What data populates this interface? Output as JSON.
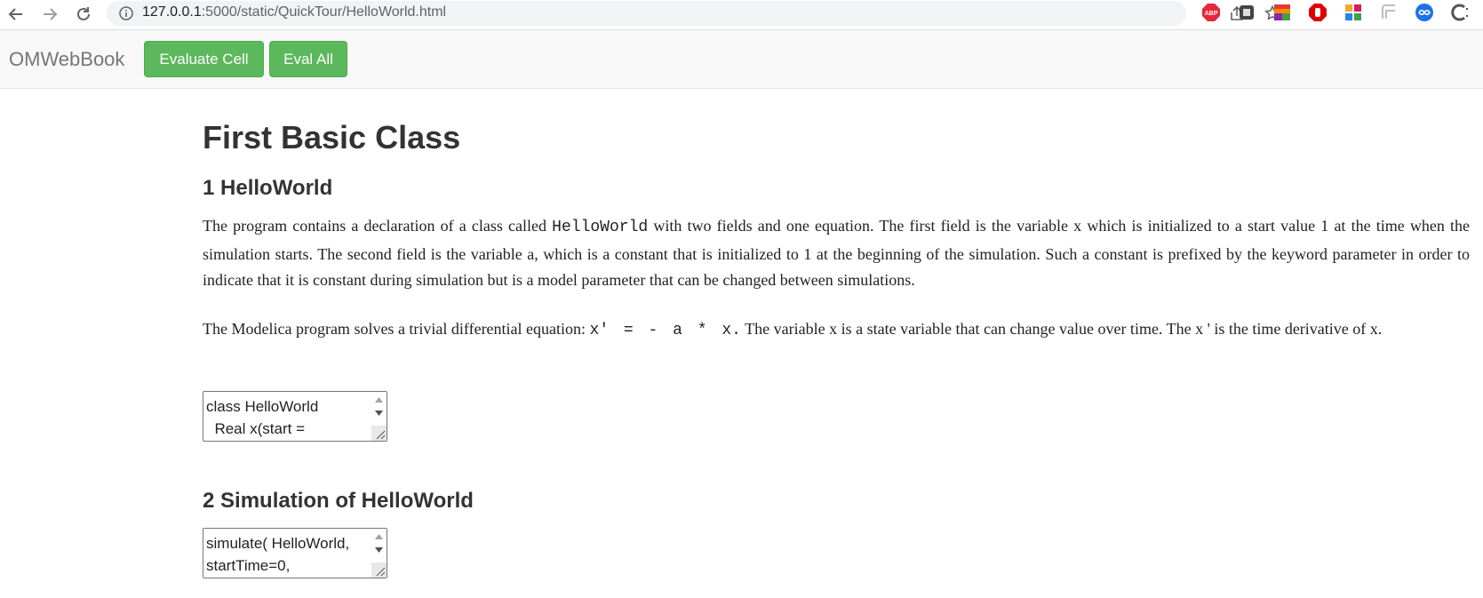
{
  "browser": {
    "url_host": "127.0.0.1",
    "url_rest": ":5000/static/QuickTour/HelloWorld.html"
  },
  "navbar": {
    "brand": "OMWebBook",
    "evaluate_cell_label": "Evaluate Cell",
    "eval_all_label": "Eval All",
    "button_color": "#5cb85c"
  },
  "page": {
    "title": "First Basic Class",
    "section1": {
      "heading": "1 HelloWorld",
      "para1_a": "The program contains a declaration of a class called ",
      "para1_code": "HelloWorld",
      "para1_b": " with two fields and one equation. The first field is the variable x which is initialized to a start value 1 at the time when the simulation starts. The second field is the variable a, which is a constant that is initialized to 1 at the beginning of the simulation. Such a constant is prefixed by the keyword parameter in order to indicate that it is constant during simulation but is a model parameter that can be changed between simulations.",
      "para2_a": "The Modelica program solves a trivial differential equation: ",
      "para2_code": "x' = - a * x.",
      "para2_b": " The variable x is a state variable that can change value over time. The x ' is the time derivative of x.",
      "code_cell": "class HelloWorld\n  Real x(start ="
    },
    "section2": {
      "heading": "2 Simulation of HelloWorld",
      "code_cell": "simulate( HelloWorld,\nstartTime=0,"
    }
  }
}
